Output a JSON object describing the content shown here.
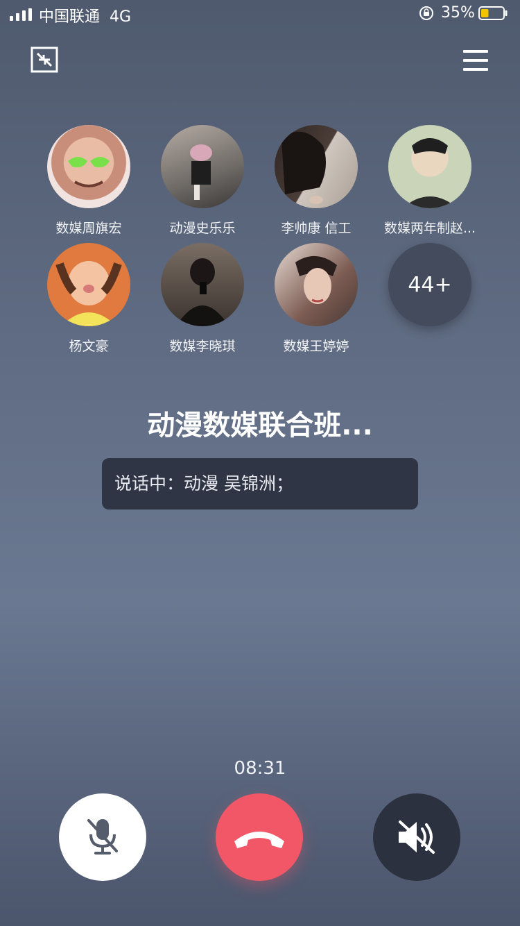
{
  "status_bar": {
    "carrier": "中国联通",
    "network": "4G",
    "battery_percent": "35%",
    "battery_level": 0.35,
    "battery_color": "#f5c400"
  },
  "call": {
    "group_name": "动漫数媒联合班...",
    "speaking_text": "说话中：动漫 吴锦洲；",
    "timer": "08:31",
    "more_count": "44+"
  },
  "members": [
    {
      "name": "数媒周旗宏",
      "avatar_color": "#d9a58d"
    },
    {
      "name": "动漫史乐乐",
      "avatar_color": "#8b8680"
    },
    {
      "name": "李帅康 信工",
      "avatar_color": "#3a2e2b"
    },
    {
      "name": "数媒两年制赵...",
      "avatar_color": "#c9d4b8"
    },
    {
      "name": "杨文豪",
      "avatar_color": "#f2c94c"
    },
    {
      "name": "数媒李晓琪",
      "avatar_color": "#2a2422"
    },
    {
      "name": "数媒王婷婷",
      "avatar_color": "#5b4a46"
    }
  ],
  "icons": {
    "shrink": "minimize-window-icon",
    "menu": "menu-icon",
    "mic": "microphone-muted-icon",
    "hangup": "hang-up-icon",
    "speaker": "speaker-muted-icon"
  },
  "colors": {
    "hangup": "#f25767",
    "speaker_bg": "#2c3140",
    "mic_bg": "#ffffff"
  }
}
